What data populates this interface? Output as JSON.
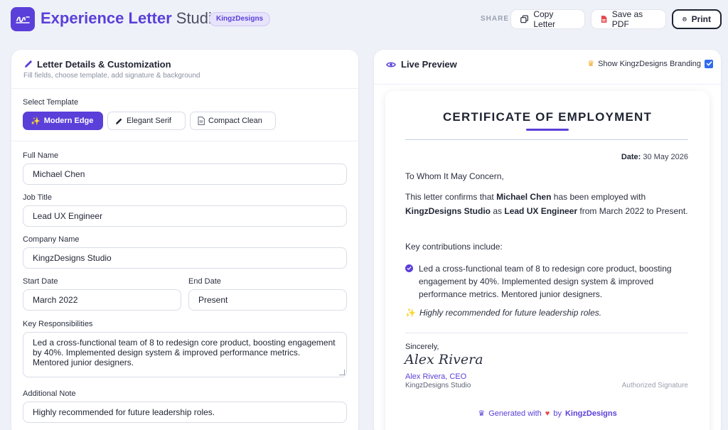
{
  "header": {
    "title_bold": "Experience Letter",
    "title_light": "Studio",
    "brand_badge": "KingzDesigns",
    "share_label": "SHARE",
    "copy_label": "Copy Letter",
    "pdf_label": "Save as PDF",
    "print_label": "Print"
  },
  "form": {
    "panel_title": "Letter Details & Customization",
    "panel_subtitle": "Fill fields, choose template, add signature & background",
    "template_label": "Select Template",
    "templates": [
      {
        "label": "Modern Edge",
        "icon": "sparkle-icon"
      },
      {
        "label": "Elegant Serif",
        "icon": "pen-icon"
      },
      {
        "label": "Compact Clean",
        "icon": "document-icon"
      }
    ],
    "full_name_label": "Full Name",
    "full_name": "Michael Chen",
    "job_title_label": "Job Title",
    "job_title": "Lead UX Engineer",
    "company_label": "Company Name",
    "company": "KingzDesigns Studio",
    "start_date_label": "Start Date",
    "start_date": "March 2022",
    "end_date_label": "End Date",
    "end_date": "Present",
    "responsibilities_label": "Key Responsibilities",
    "responsibilities": "Led a cross-functional team of 8 to redesign core product, boosting engagement by 40%. Implemented design system & improved performance metrics. Mentored junior designers.",
    "note_label": "Additional Note",
    "note": "Highly recommended for future leadership roles."
  },
  "preview": {
    "panel_title": "Live Preview",
    "branding_label": "Show KingzDesigns Branding",
    "letter_title": "CERTIFICATE OF EMPLOYMENT",
    "date_label": "Date:",
    "date_value": "30 May 2026",
    "salutation": "To Whom It May Concern,",
    "body": {
      "p1": "This letter confirms that",
      "name": "Michael Chen",
      "p2": "has been employed with",
      "company": "KingzDesigns Studio",
      "p3": "as",
      "role": "Lead UX Engineer",
      "p4": "from March 2022 to Present."
    },
    "contributions_intro": "Key contributions include:",
    "contribution_item": "Led a cross-functional team of 8 to redesign core product, boosting engagement by 40%. Implemented design system & improved performance metrics. Mentored junior designers.",
    "note": "Highly recommended for future leadership roles.",
    "closing": "Sincerely,",
    "signature": "Alex Rivera",
    "signer": "Alex Rivera, CEO",
    "signer_company": "KingzDesigns Studio",
    "authorized": "Authorized Signature",
    "footer_pre": "Generated with",
    "footer_by": "by",
    "footer_brand": "KingzDesigns"
  },
  "colors": {
    "accent": "#5b3fd9",
    "background": "#eef1f8",
    "checkbox": "#2f6cf0"
  }
}
